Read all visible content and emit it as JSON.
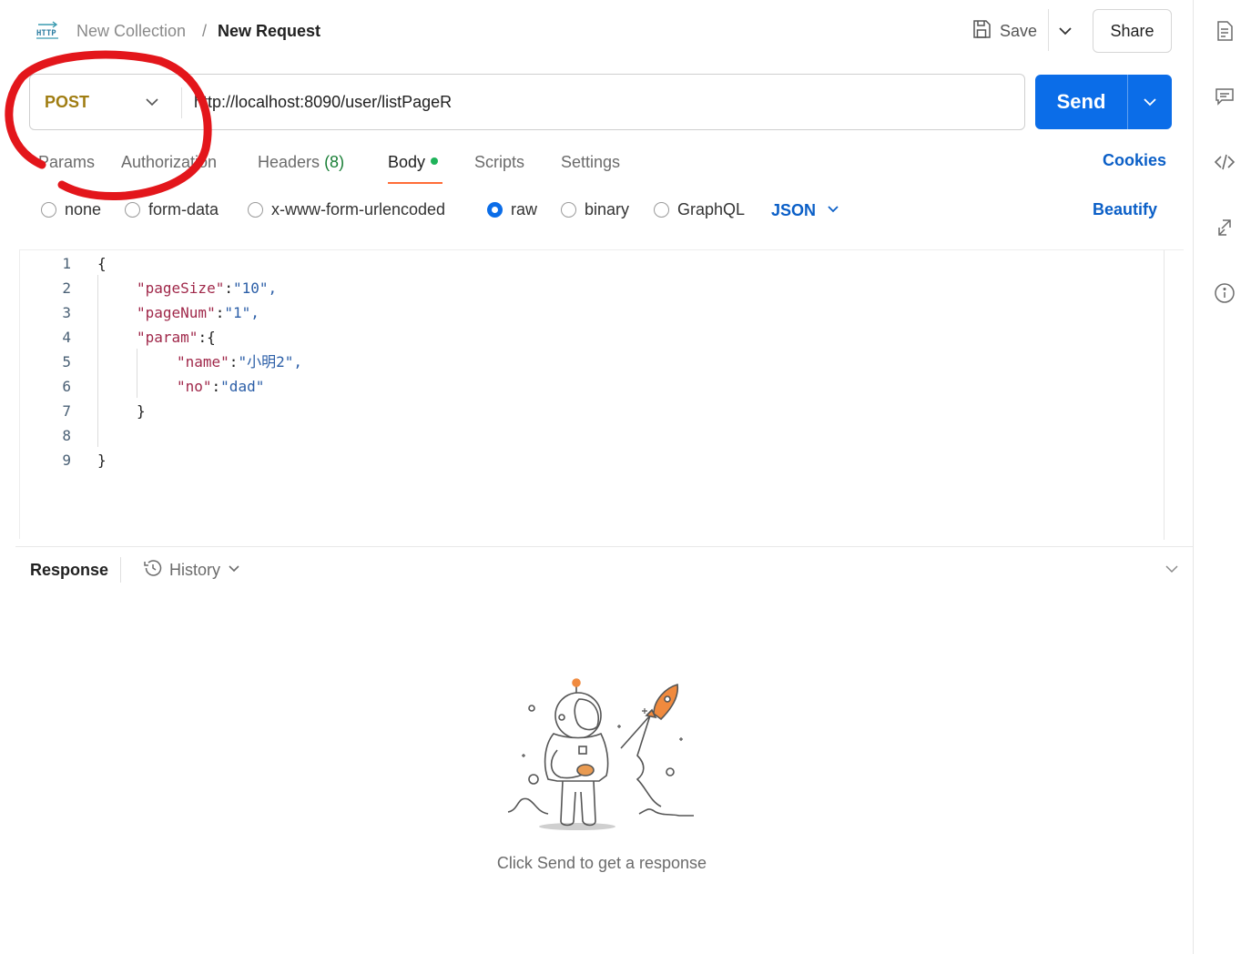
{
  "breadcrumb": {
    "collection": "New Collection",
    "separator": "/",
    "request": "New Request"
  },
  "header": {
    "save_label": "Save",
    "share_label": "Share"
  },
  "request": {
    "method": "POST",
    "url": "http://localhost:8090/user/listPageR",
    "send_label": "Send"
  },
  "tabs": [
    {
      "label": "Params"
    },
    {
      "label": "Authorization"
    },
    {
      "label": "Headers",
      "count": "(8)"
    },
    {
      "label": "Body",
      "active": true
    },
    {
      "label": "Scripts"
    },
    {
      "label": "Settings"
    }
  ],
  "cookies_label": "Cookies",
  "body_modes": [
    {
      "label": "none",
      "selected": false
    },
    {
      "label": "form-data",
      "selected": false
    },
    {
      "label": "x-www-form-urlencoded",
      "selected": false
    },
    {
      "label": "raw",
      "selected": true
    },
    {
      "label": "binary",
      "selected": false
    },
    {
      "label": "GraphQL",
      "selected": false
    }
  ],
  "format_selected": "JSON",
  "beautify_label": "Beautify",
  "editor": {
    "lines": [
      {
        "n": "1",
        "text": "{"
      },
      {
        "n": "2",
        "key": "\"pageSize\"",
        "value": "\"10\","
      },
      {
        "n": "3",
        "key": "\"pageNum\"",
        "value": "\"1\","
      },
      {
        "n": "4",
        "key": "\"param\"",
        "value": "{"
      },
      {
        "n": "5",
        "key": "\"name\"",
        "value": "\"小明2\","
      },
      {
        "n": "6",
        "key": "\"no\"",
        "value": "\"dad\""
      },
      {
        "n": "7",
        "text": "}"
      },
      {
        "n": "8",
        "text": ""
      },
      {
        "n": "9",
        "text": "}"
      }
    ]
  },
  "response": {
    "title": "Response",
    "history_label": "History",
    "empty_message": "Click Send to get a response"
  },
  "annotation": {
    "color": "#e3161b"
  },
  "colors": {
    "accent": "#0b6de8",
    "method": "#a07d12",
    "tab_indicator": "#ff6c37",
    "link": "#0b5fc7"
  },
  "icons": {
    "http": "http-icon",
    "save": "save-icon",
    "rightbar": [
      "documentation-icon",
      "comments-icon",
      "code-icon",
      "related-icon",
      "info-icon"
    ]
  }
}
